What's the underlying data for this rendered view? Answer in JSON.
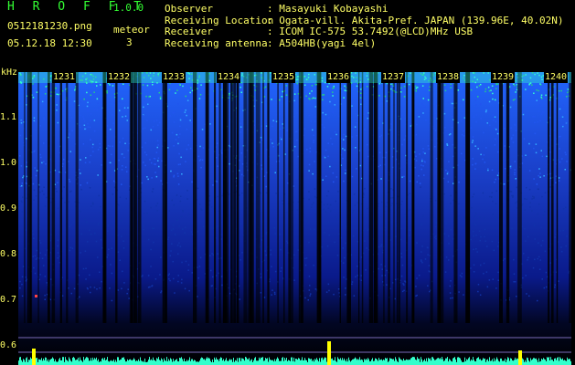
{
  "header": {
    "app_name": "H R O F F T",
    "version": "1.0.0",
    "filename": "0512181230.png",
    "datetime": "05.12.18 12:30",
    "meteor_label": "meteor",
    "meteor_count": "3"
  },
  "info": [
    {
      "key": "Observer",
      "value": ": Masayuki Kobayashi"
    },
    {
      "key": "Receiving Location",
      "value": ": Ogata-vill. Akita-Pref. JAPAN (139.96E, 40.02N)"
    },
    {
      "key": "Receiver",
      "value": ": ICOM IC-575 53.7492(@LCD)MHz USB"
    },
    {
      "key": "Receiving antenna",
      "value": ": A504HB(yagi 4el)"
    }
  ],
  "axis": {
    "unit": "kHz",
    "ticks": [
      "1.1",
      "1.0",
      "0.9",
      "0.8",
      "0.7",
      "0.6"
    ]
  },
  "minutes": [
    "1231",
    "1232",
    "1233",
    "1234",
    "1235",
    "1236",
    "1237",
    "1238",
    "1239",
    "1240"
  ],
  "colors": {
    "text": "#ffff66",
    "title": "#33ff33",
    "signal_bright": "#33ffcc",
    "signal_mid": "#2266ff",
    "signal_dim": "#0a1a8a"
  }
}
